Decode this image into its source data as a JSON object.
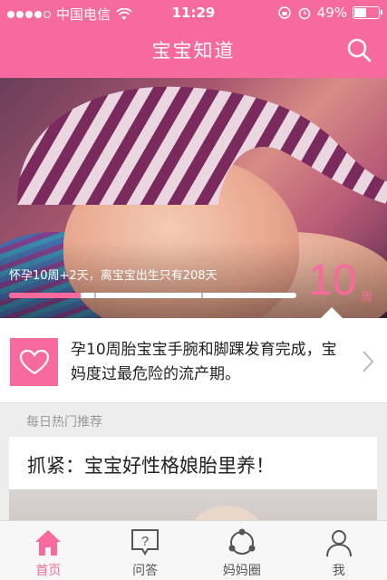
{
  "status_bar": {
    "carrier": "中国电信",
    "time": "11:29",
    "battery": "49%"
  },
  "nav": {
    "title": "宝宝知道",
    "search_icon": "search-icon"
  },
  "hero": {
    "pregnancy_text": "怀孕10周+2天，离宝宝出生只有208天",
    "week_number": "10",
    "week_unit": "周",
    "progress_fraction": 0.25
  },
  "info_card": {
    "icon": "heart-icon",
    "text": "孕10周胎宝宝手腕和脚踝发育完成，宝妈度过最危险的流产期。"
  },
  "section": {
    "title": "每日热门推荐"
  },
  "article": {
    "title": "抓紧：宝宝好性格娘胎里养！"
  },
  "tabbar": {
    "items": [
      {
        "label": "首页",
        "icon": "home-icon",
        "active": true
      },
      {
        "label": "问答",
        "icon": "question-icon",
        "active": false
      },
      {
        "label": "妈妈圈",
        "icon": "circle-icon",
        "active": false
      },
      {
        "label": "我",
        "icon": "user-icon",
        "active": false
      }
    ]
  },
  "colors": {
    "accent": "#f66a9d"
  }
}
